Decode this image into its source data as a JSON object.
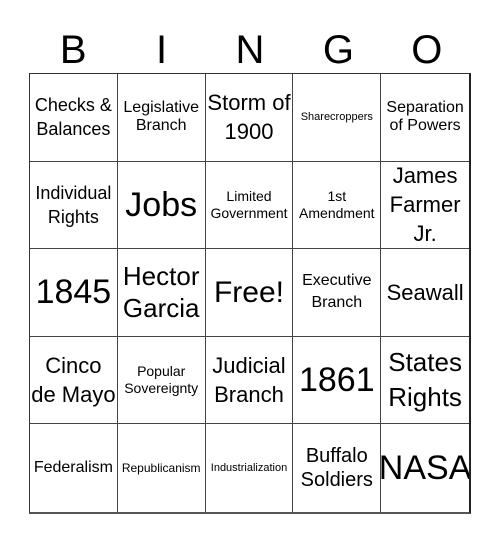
{
  "header": {
    "letters": [
      "B",
      "I",
      "N",
      "G",
      "O"
    ]
  },
  "card": {
    "cells": [
      "Checks & Balances",
      "Legislative Branch",
      "Storm of 1900",
      "Sharecroppers",
      "Separation of Powers",
      "Individual Rights",
      "Jobs",
      "Limited Government",
      "1st Amendment",
      "James Farmer Jr.",
      "1845",
      "Hector Garcia",
      "Free!",
      "Executive Branch",
      "Seawall",
      "Cinco de Mayo",
      "Popular Sovereignty",
      "Judicial Branch",
      "1861",
      "States Rights",
      "Federalism",
      "Republicanism",
      "Industrialization",
      "Buffalo Soldiers",
      "NASA"
    ],
    "free_space_index": 12
  }
}
